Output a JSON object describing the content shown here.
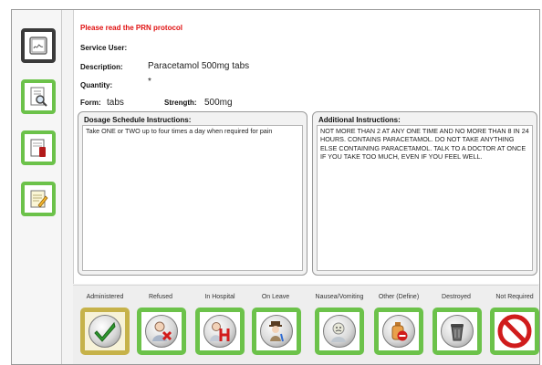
{
  "protocol_warning": "Please read the PRN protocol",
  "fields": {
    "service_user_label": "Service User:",
    "service_user_value": "",
    "description_label": "Description:",
    "description_value": "Paracetamol 500mg tabs",
    "quantity_label": "Quantity:",
    "quantity_value": "*",
    "form_label": "Form:",
    "form_value": "tabs",
    "strength_label": "Strength:",
    "strength_value": "500mg"
  },
  "dosage": {
    "title": "Dosage Schedule Instructions:",
    "text": "Take ONE or TWO up to four times a day when required for pain"
  },
  "additional": {
    "title": "Additional Instructions:",
    "text": "NOT MORE THAN 2 AT ANY ONE TIME AND NO MORE THAN 8 IN 24 HOURS. CONTAINS PARACETAMOL. DO NOT TAKE ANYTHING ELSE CONTAINING PARACETAMOL. TALK TO A DOCTOR AT ONCE IF YOU TAKE TOO MUCH, EVEN IF YOU FEEL WELL."
  },
  "sidebar_icons": [
    "signature-pad-icon",
    "magnifier-document-icon",
    "medication-book-icon",
    "notepad-pencil-icon"
  ],
  "actions": [
    {
      "label": "Administered",
      "icon": "green-check-icon"
    },
    {
      "label": "Refused",
      "icon": "person-red-x-icon"
    },
    {
      "label": "In Hospital",
      "icon": "hospital-h-icon"
    },
    {
      "label": "On Leave",
      "icon": "person-hat-walking-icon"
    },
    {
      "label": "Nausea/Vomiting",
      "icon": "sick-person-icon"
    },
    {
      "label": "Other (Define)",
      "icon": "bottle-no-entry-icon"
    },
    {
      "label": "Destroyed",
      "icon": "waste-bin-icon"
    },
    {
      "label": "Not Required",
      "icon": "prohibited-icon"
    }
  ],
  "colors": {
    "green_border": "#6cc24a",
    "selected_border": "#c6b24a",
    "warning_red": "#e01010"
  }
}
